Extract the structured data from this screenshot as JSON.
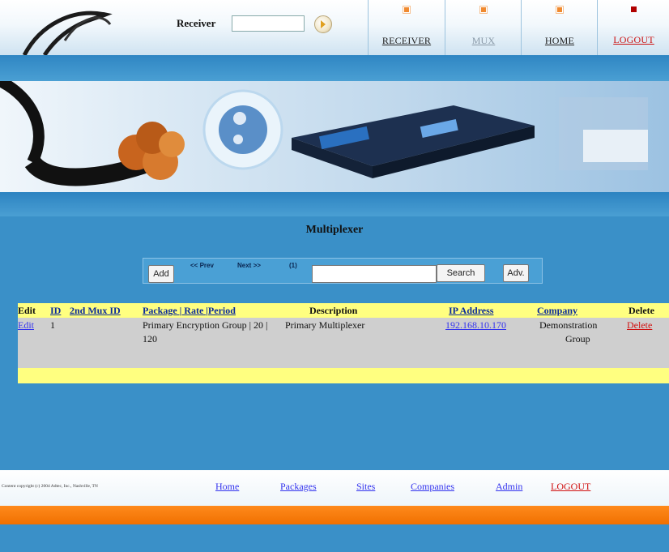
{
  "header": {
    "receiver_label": "Receiver",
    "receiver_value": "",
    "nav": [
      {
        "label": "RECEIVER",
        "color": "#222222"
      },
      {
        "label": "MUX",
        "color": "#8a9aa8"
      },
      {
        "label": "HOME",
        "color": "#222222"
      },
      {
        "label": "LOGOUT",
        "color": "#cc1111"
      }
    ]
  },
  "page": {
    "title": "Multiplexer"
  },
  "toolbar": {
    "add_label": "Add",
    "prev_label": "<< Prev",
    "next_label": "Next >>",
    "count_label": "(1)",
    "search_value": "",
    "search_label": "Search",
    "adv_label": "Adv."
  },
  "table": {
    "headers": {
      "edit": "Edit",
      "id": "ID",
      "mux2": "2nd Mux ID",
      "package": "Package | Rate |Period",
      "description": "Description",
      "ip": "IP Address",
      "company": "Company",
      "delete": "Delete"
    },
    "rows": [
      {
        "edit": "Edit",
        "id": "1",
        "mux2": "",
        "package_line1": "Primary Encryption Group | 20 |",
        "package_line2": "120",
        "description": "Primary Multiplexer",
        "ip": "192.168.10.170",
        "company_line1": "Demonstration",
        "company_line2": "Group",
        "delete": "Delete"
      }
    ]
  },
  "footer": {
    "copyright": "Content copyright (c) 2004 Adtec, Inc., Nashville, TN",
    "links": [
      "Home",
      "Packages",
      "Sites",
      "Companies",
      "Admin",
      "LOGOUT"
    ]
  },
  "colors": {
    "page_bg": "#3a90c8",
    "header_row": "#ffff80",
    "orange_bar": "#f07800"
  }
}
